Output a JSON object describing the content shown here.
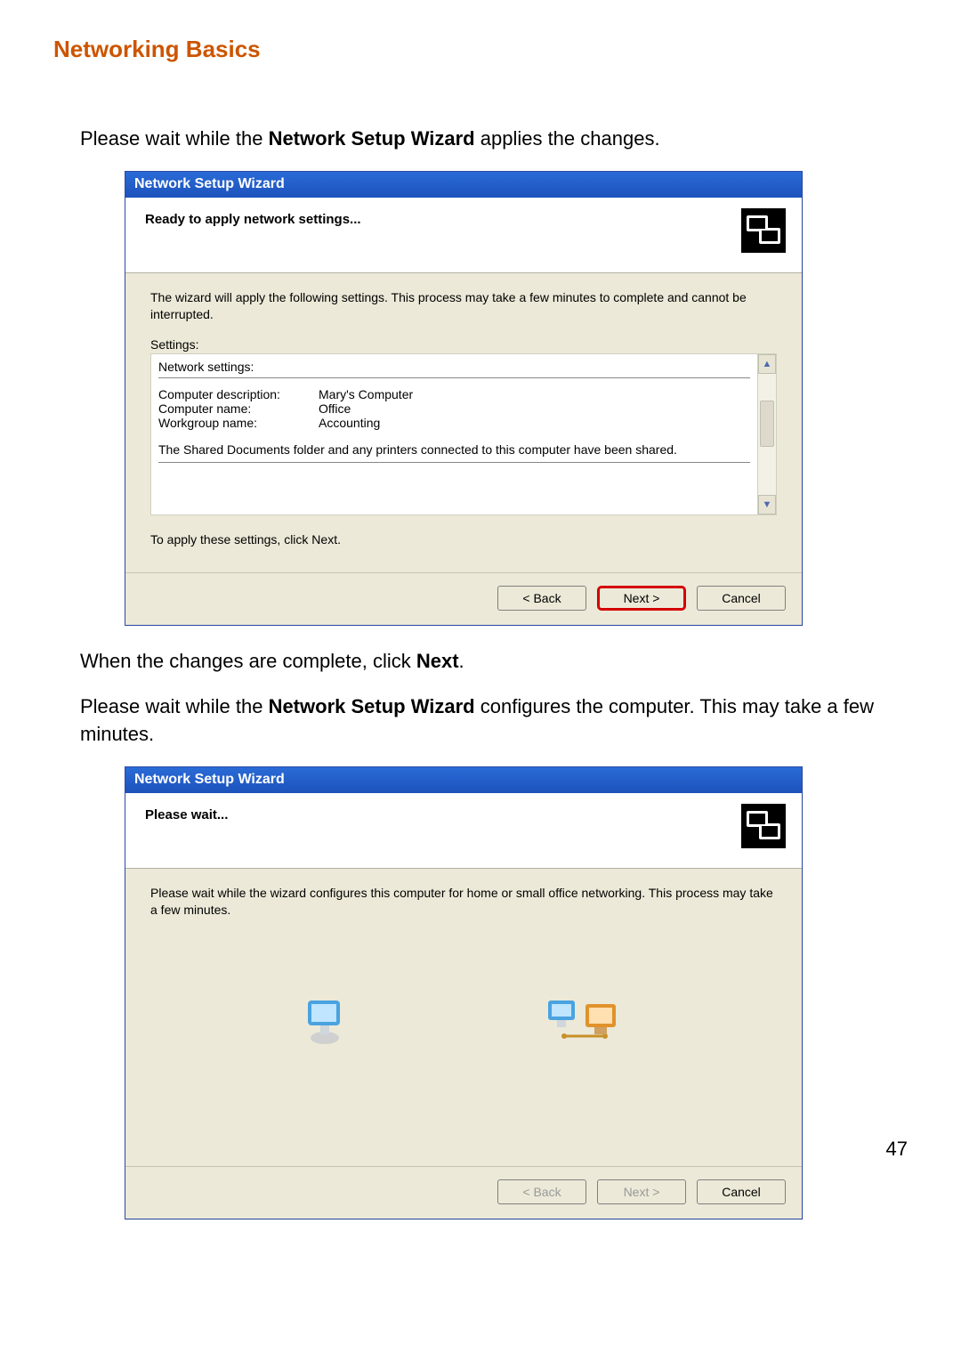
{
  "page": {
    "title": "Networking Basics",
    "number": "47"
  },
  "text": {
    "intro_prefix": "Please wait while the ",
    "intro_bold": "Network Setup Wizard",
    "intro_suffix": " applies the changes.",
    "mid_prefix": "When the changes are complete, click ",
    "mid_bold": "Next",
    "mid_suffix": ".",
    "para2_prefix": "Please wait while the ",
    "para2_bold": "Network Setup Wizard",
    "para2_suffix": " configures the computer. This may take a few minutes."
  },
  "wizard1": {
    "titlebar": "Network Setup Wizard",
    "header": "Ready to apply network settings...",
    "body_intro": "The wizard will apply the following settings. This process may take a few minutes to complete and cannot be interrupted.",
    "settings_label": "Settings:",
    "settings_heading": "Network settings:",
    "rows": [
      {
        "k": "Computer description:",
        "v": "Mary's Computer"
      },
      {
        "k": "Computer name:",
        "v": "Office"
      },
      {
        "k": "Workgroup name:",
        "v": "Accounting"
      }
    ],
    "shared_note": "The Shared Documents folder and any printers connected to this computer have been shared.",
    "apply_hint": "To apply these settings, click Next.",
    "buttons": {
      "back": "< Back",
      "next": "Next >",
      "cancel": "Cancel"
    }
  },
  "wizard2": {
    "titlebar": "Network Setup Wizard",
    "header": "Please wait...",
    "body_intro": "Please wait while the wizard configures this computer for home or small office networking. This process may take a few minutes.",
    "buttons": {
      "back": "< Back",
      "next": "Next >",
      "cancel": "Cancel"
    }
  }
}
